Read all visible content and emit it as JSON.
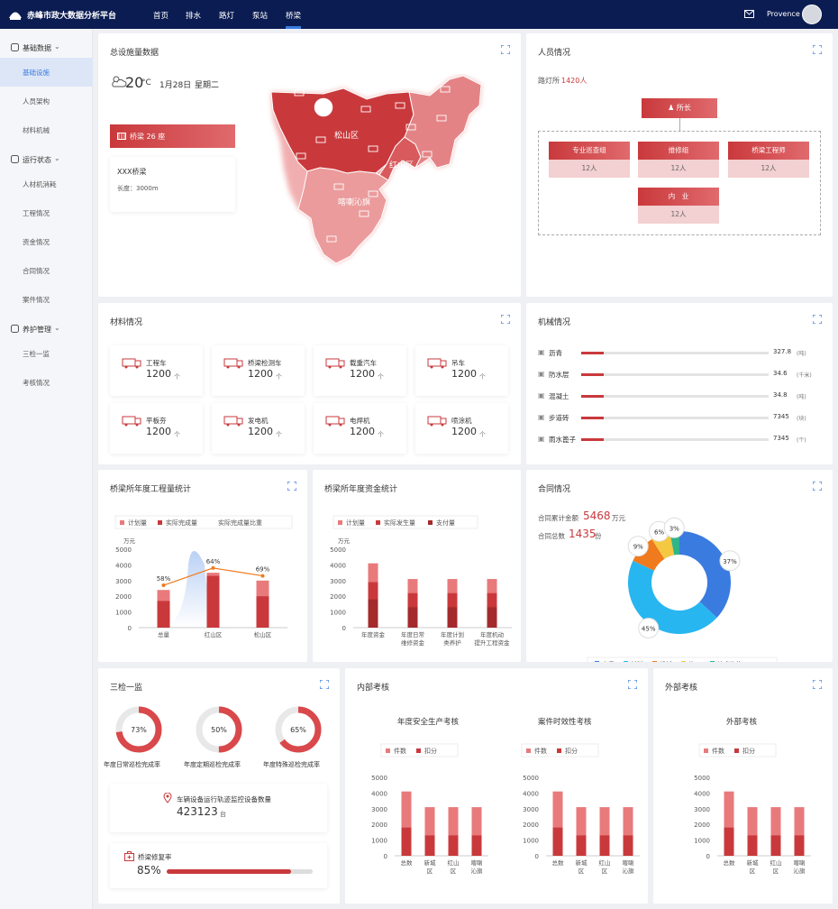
{
  "app": {
    "title": "赤峰市政大数据分析平台",
    "user": "Provence",
    "nav": [
      "首页",
      "排水",
      "路灯",
      "泵站",
      "桥梁"
    ],
    "active_nav": "桥梁"
  },
  "sidebar": {
    "groups": [
      {
        "label": "基础数据",
        "items": [
          "基础设施",
          "人员架构",
          "材料机械"
        ]
      },
      {
        "label": "运行状态",
        "items": [
          "人材机消耗",
          "工程情况",
          "资金情况",
          "合同情况",
          "案件情况"
        ]
      },
      {
        "label": "养护管理",
        "items": [
          "三检一监",
          "考核情况"
        ]
      }
    ],
    "active_item": "基础设施"
  },
  "facilities": {
    "title": "总设施量数据",
    "temp": "20",
    "temp_unit": "°C",
    "date": "1月28日",
    "weekday": "星期二",
    "bridge_label": "桥梁 26 座",
    "bridge_name": "XXX桥梁",
    "bridge_length": "长度：3000m",
    "districts": [
      "松山区",
      "红山区",
      "喀喇沁旗"
    ]
  },
  "personnel": {
    "title": "人员情况",
    "org_label": "路灯所",
    "org_count": "1420人",
    "head": "所长",
    "teams": [
      {
        "name": "专业巡查组",
        "count": "12人"
      },
      {
        "name": "维修组",
        "count": "12人"
      },
      {
        "name": "桥梁工程师",
        "count": "12人"
      },
      {
        "name": "内　业",
        "count": "12人"
      }
    ]
  },
  "materials": {
    "title": "材料情况",
    "unit": "个",
    "items": [
      {
        "name": "工程车",
        "value": "1200",
        "icon": "truck-icon"
      },
      {
        "name": "桥梁检测车",
        "value": "1200",
        "icon": "inspection-truck-icon"
      },
      {
        "name": "载重汽车",
        "value": "1200",
        "icon": "lorry-icon"
      },
      {
        "name": "吊车",
        "value": "1200",
        "icon": "crane-icon"
      },
      {
        "name": "平板夯",
        "value": "1200",
        "icon": "tamper-icon"
      },
      {
        "name": "发电机",
        "value": "1200",
        "icon": "generator-icon"
      },
      {
        "name": "电焊机",
        "value": "1200",
        "icon": "welder-icon"
      },
      {
        "name": "喷涂机",
        "value": "1200",
        "icon": "sprayer-icon"
      }
    ]
  },
  "machinery": {
    "title": "机械情况",
    "items": [
      {
        "name": "沥青",
        "value": "327.8",
        "unit": "(吨)",
        "fill": 0.12
      },
      {
        "name": "防水层",
        "value": "34.6",
        "unit": "(千米)",
        "fill": 0.12
      },
      {
        "name": "混凝土",
        "value": "34.8",
        "unit": "(吨)",
        "fill": 0.12
      },
      {
        "name": "步道砖",
        "value": "7345",
        "unit": "(块)",
        "fill": 0.12
      },
      {
        "name": "雨水篦子",
        "value": "7345",
        "unit": "(个)",
        "fill": 0.12
      }
    ]
  },
  "work_stats": {
    "title": "桥梁所年度工程量统计",
    "legend": [
      "计划量",
      "实际完成量",
      "实际完成量比重"
    ],
    "unit": "万元"
  },
  "fund_stats": {
    "title": "桥梁所年度资金统计",
    "legend": [
      "计划量",
      "实际发生量",
      "支付量"
    ],
    "unit": "万元"
  },
  "contract": {
    "title": "合同情况",
    "amount_label": "合同累计金额",
    "amount": "5468",
    "amount_unit": "万元",
    "count_label": "合同总数",
    "count": "1435",
    "count_unit": "份"
  },
  "inspection": {
    "title": "三检一监",
    "rings": [
      {
        "pct": "73%",
        "value": 0.73,
        "label": "年度日常巡检完成率"
      },
      {
        "pct": "50%",
        "value": 0.5,
        "label": "年度定期巡检完成率"
      },
      {
        "pct": "65%",
        "value": 0.65,
        "label": "年度特殊巡检完成率"
      }
    ],
    "device_label": "车辆设备运行轨迹监控设备数量",
    "device_count": "423123",
    "device_unit": "台",
    "repair_label": "桥梁修复率",
    "repair_pct": "85%",
    "repair_value": 0.85
  },
  "internal": {
    "title": "内部考核",
    "sub1": "年度安全生产考核",
    "sub2": "案件时效性考核",
    "legend": [
      "件数",
      "扣分"
    ]
  },
  "external": {
    "title": "外部考核",
    "sub1": "外部考核",
    "legend": [
      "件数",
      "扣分"
    ]
  },
  "colors": {
    "red": "#c9393c",
    "pink": "#e87a7c",
    "dark_red": "#a42a2c",
    "orange": "#f07a1e",
    "navy": "#0b1c52",
    "accent_blue": "#3a7be0"
  },
  "chart_data": [
    {
      "type": "bar",
      "title": "桥梁所年度工程量统计",
      "categories": [
        "总量",
        "红山区",
        "松山区"
      ],
      "series": [
        {
          "name": "计划量",
          "values": [
            2400,
            3500,
            3000
          ]
        },
        {
          "name": "实际完成量",
          "values": [
            1700,
            3300,
            2000
          ]
        },
        {
          "name": "实际完成量比重",
          "values": [
            58,
            64,
            69
          ],
          "type": "line",
          "unit": "%"
        }
      ],
      "ylabel": "万元",
      "ylim": [
        0,
        5000
      ],
      "yticks": [
        0,
        1000,
        2000,
        3000,
        4000,
        5000
      ]
    },
    {
      "type": "bar",
      "title": "桥梁所年度资金统计",
      "categories": [
        "年度资金",
        "年度日常维修资金",
        "年度计划类养护",
        "年度机动提升工程资金"
      ],
      "series": [
        {
          "name": "计划量",
          "values": [
            4100,
            3100,
            3100,
            3100
          ]
        },
        {
          "name": "实际发生量",
          "values": [
            2900,
            2200,
            2200,
            2200
          ]
        },
        {
          "name": "支付量",
          "values": [
            1800,
            1300,
            1300,
            1300
          ]
        }
      ],
      "ylabel": "万元",
      "ylim": [
        0,
        5000
      ],
      "yticks": [
        0,
        1000,
        2000,
        3000,
        4000,
        5000
      ]
    },
    {
      "type": "pie",
      "title": "合同情况",
      "labels": [
        "人员",
        "材料",
        "机械",
        "施工",
        "技术咨询"
      ],
      "values": [
        37,
        45,
        9,
        6,
        3
      ],
      "colors": [
        "#3a7be0",
        "#28b6f0",
        "#f07a1e",
        "#f5c842",
        "#2fb58a"
      ]
    },
    {
      "type": "bar",
      "title": "年度安全生产考核",
      "categories": [
        "总数",
        "新城区",
        "红山区",
        "喀喇沁旗"
      ],
      "series": [
        {
          "name": "件数",
          "values": [
            4100,
            3100,
            3100,
            3100
          ]
        },
        {
          "name": "扣分",
          "values": [
            1800,
            1300,
            1300,
            1300
          ]
        }
      ],
      "ylim": [
        0,
        5000
      ],
      "yticks": [
        0,
        1000,
        2000,
        3000,
        4000,
        5000
      ]
    },
    {
      "type": "bar",
      "title": "案件时效性考核",
      "categories": [
        "总数",
        "新城区",
        "红山区",
        "喀喇沁旗"
      ],
      "series": [
        {
          "name": "件数",
          "values": [
            4100,
            3100,
            3100,
            3100
          ]
        },
        {
          "name": "扣分",
          "values": [
            1800,
            1300,
            1300,
            1300
          ]
        }
      ],
      "ylim": [
        0,
        5000
      ],
      "yticks": [
        0,
        1000,
        2000,
        3000,
        4000,
        5000
      ]
    },
    {
      "type": "bar",
      "title": "外部考核",
      "categories": [
        "总数",
        "新城区",
        "红山区",
        "喀喇沁旗"
      ],
      "series": [
        {
          "name": "件数",
          "values": [
            4100,
            3100,
            3100,
            3100
          ]
        },
        {
          "name": "扣分",
          "values": [
            1800,
            1300,
            1300,
            1300
          ]
        }
      ],
      "ylim": [
        0,
        5000
      ],
      "yticks": [
        0,
        1000,
        2000,
        3000,
        4000,
        5000
      ]
    }
  ]
}
